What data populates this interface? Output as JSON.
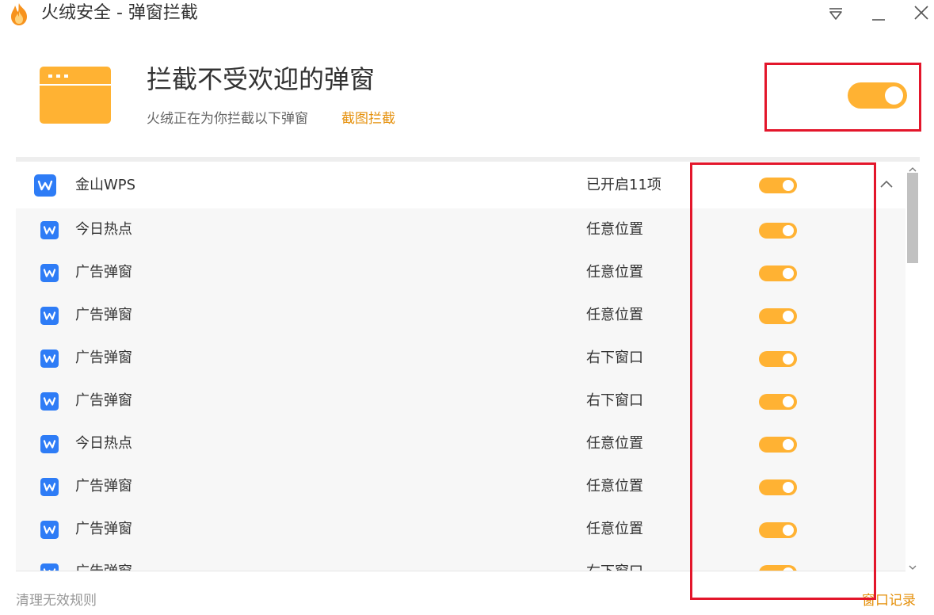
{
  "window": {
    "title": "火绒安全 - 弹窗拦截"
  },
  "colors": {
    "accent": "#ffb233",
    "link": "#e5900b",
    "highlight": "#e3162b",
    "wps_blue": "#2e7cf6"
  },
  "icons": {
    "app": "huorong-flame-icon",
    "menu": "menu-triangle-icon",
    "minimize": "minimize-icon",
    "close": "close-icon",
    "hero": "popup-window-icon",
    "wps": "wps-icon",
    "collapse": "chevron-up-icon"
  },
  "header": {
    "title": "拦截不受欢迎的弹窗",
    "subtitle": "火绒正在为你拦截以下弹窗",
    "screenshot_link": "截图拦截",
    "master_toggle_on": true
  },
  "group": {
    "name": "金山WPS",
    "status": "已开启11项",
    "enabled": true,
    "expanded": true
  },
  "rules": [
    {
      "name": "今日热点",
      "position": "任意位置",
      "enabled": true
    },
    {
      "name": "广告弹窗",
      "position": "任意位置",
      "enabled": true
    },
    {
      "name": "广告弹窗",
      "position": "任意位置",
      "enabled": true
    },
    {
      "name": "广告弹窗",
      "position": "右下窗口",
      "enabled": true
    },
    {
      "name": "广告弹窗",
      "position": "右下窗口",
      "enabled": true
    },
    {
      "name": "今日热点",
      "position": "任意位置",
      "enabled": true
    },
    {
      "name": "广告弹窗",
      "position": "任意位置",
      "enabled": true
    },
    {
      "name": "广告弹窗",
      "position": "任意位置",
      "enabled": true
    },
    {
      "name": "广告弹窗",
      "position": "右下窗口",
      "enabled": true
    }
  ],
  "footer": {
    "clean_rules": "清理无效规则",
    "window_log": "窗口记录"
  }
}
